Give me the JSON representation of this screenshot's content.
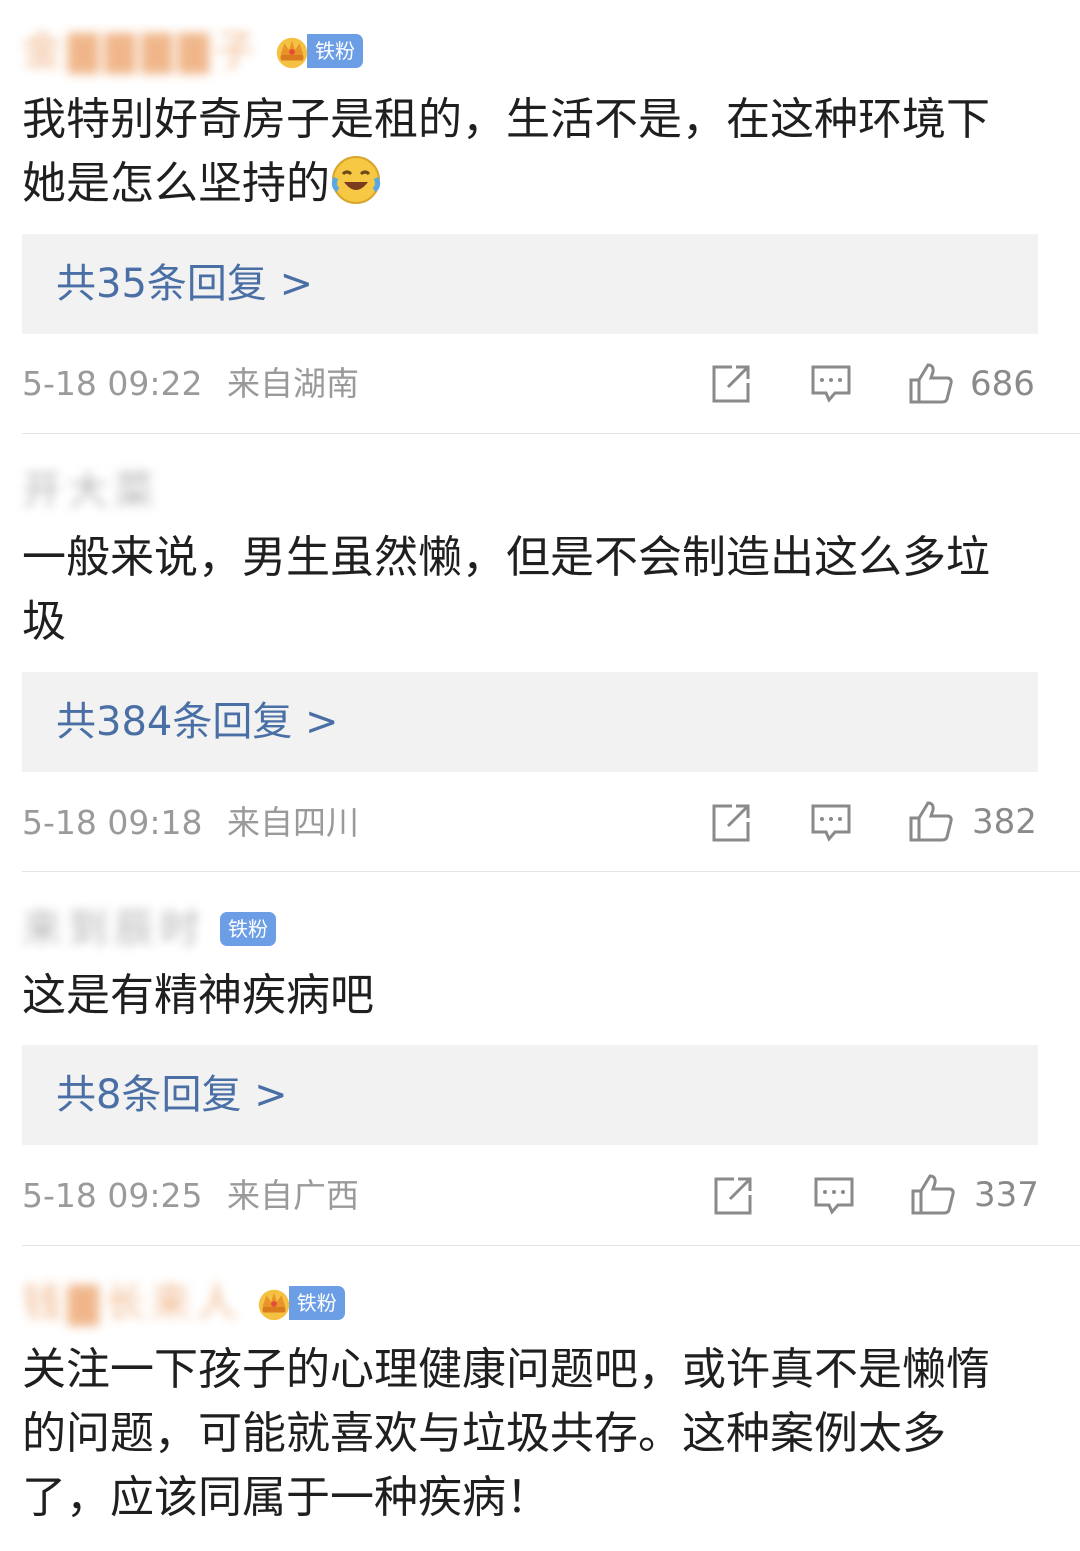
{
  "comments": [
    {
      "username": "金▇▇▇▇子",
      "badge": "铁粉",
      "text": "我特别好奇房子是租的，生活不是，在这种环境下她是怎么坚持的",
      "reply_label": "共35条回复 >",
      "date": "5-18 09:22",
      "location": "来自湖南",
      "likes": "686"
    },
    {
      "username": "开大菜",
      "text": "一般来说，男生虽然懒，但是不会制造出这么多垃圾",
      "reply_label": "共384条回复 >",
      "date": "5-18 09:18",
      "location": "来自四川",
      "likes": "382"
    },
    {
      "username": "来到辰时",
      "badge": "铁粉",
      "text": "这是有精神疾病吧",
      "reply_label": "共8条回复 >",
      "date": "5-18 09:25",
      "location": "来自广西",
      "likes": "337"
    },
    {
      "username": "钱▇长来人",
      "badge": "铁粉",
      "text": "关注一下孩子的心理健康问题吧，或许真不是懒惰的问题，可能就喜欢与垃圾共存。这种案例太多了，应该同属于一种疾病！"
    }
  ],
  "colors": {
    "reply_link": "#4a6fa5",
    "badge": "#6c9ee6",
    "username": "#e47c2c",
    "meta": "#9a9a9a"
  },
  "icons": [
    "share-icon",
    "comment-icon",
    "thumbs-up-icon",
    "crown-icon",
    "laughing-crying-emoji"
  ]
}
